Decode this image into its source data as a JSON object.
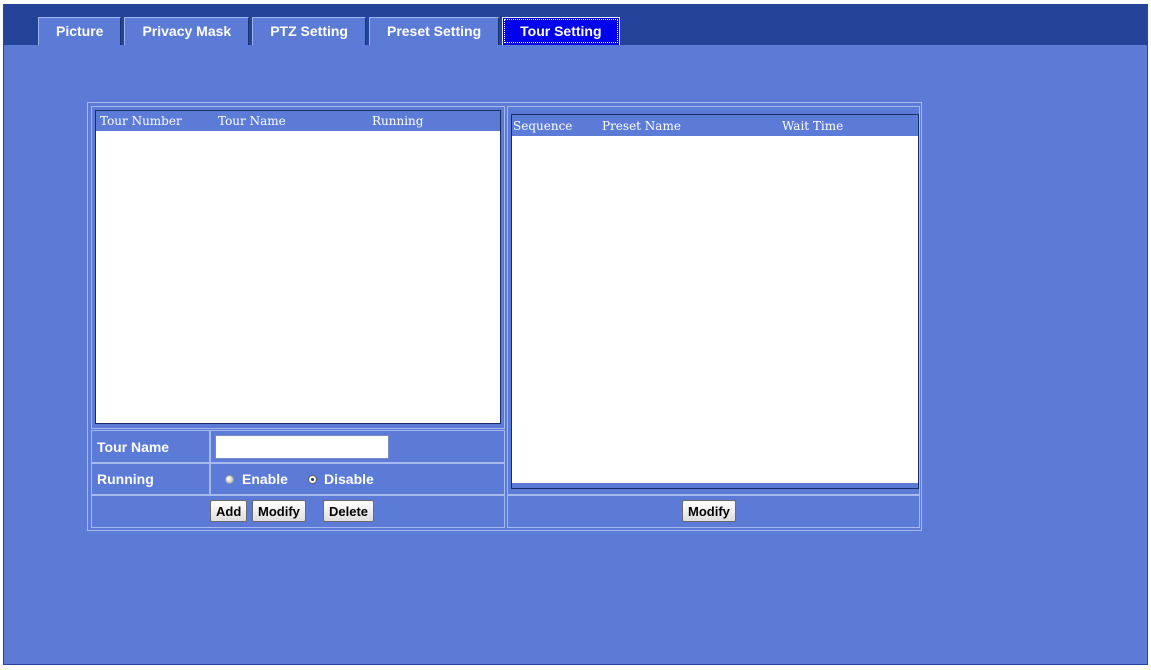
{
  "tabs": [
    {
      "label": "Picture",
      "active": false
    },
    {
      "label": "Privacy Mask",
      "active": false
    },
    {
      "label": "PTZ Setting",
      "active": false
    },
    {
      "label": "Preset Setting",
      "active": false
    },
    {
      "label": "Tour Setting",
      "active": true
    }
  ],
  "tour_list": {
    "headers": [
      "Tour Number",
      "Tour Name",
      "Running"
    ],
    "rows": []
  },
  "sequence_list": {
    "headers": [
      "Sequence",
      "Preset Name",
      "Wait Time"
    ],
    "rows": []
  },
  "form": {
    "tour_name_label": "Tour Name",
    "tour_name_value": "",
    "running_label": "Running",
    "enable_label": "Enable",
    "disable_label": "Disable",
    "running_selected": "Disable"
  },
  "buttons": {
    "add": "Add",
    "modify": "Modify",
    "delete": "Delete",
    "sequence_modify": "Modify"
  },
  "colors": {
    "background": "#5b7bd6",
    "top_bar": "#24449a",
    "active_tab": "#0000ee"
  }
}
